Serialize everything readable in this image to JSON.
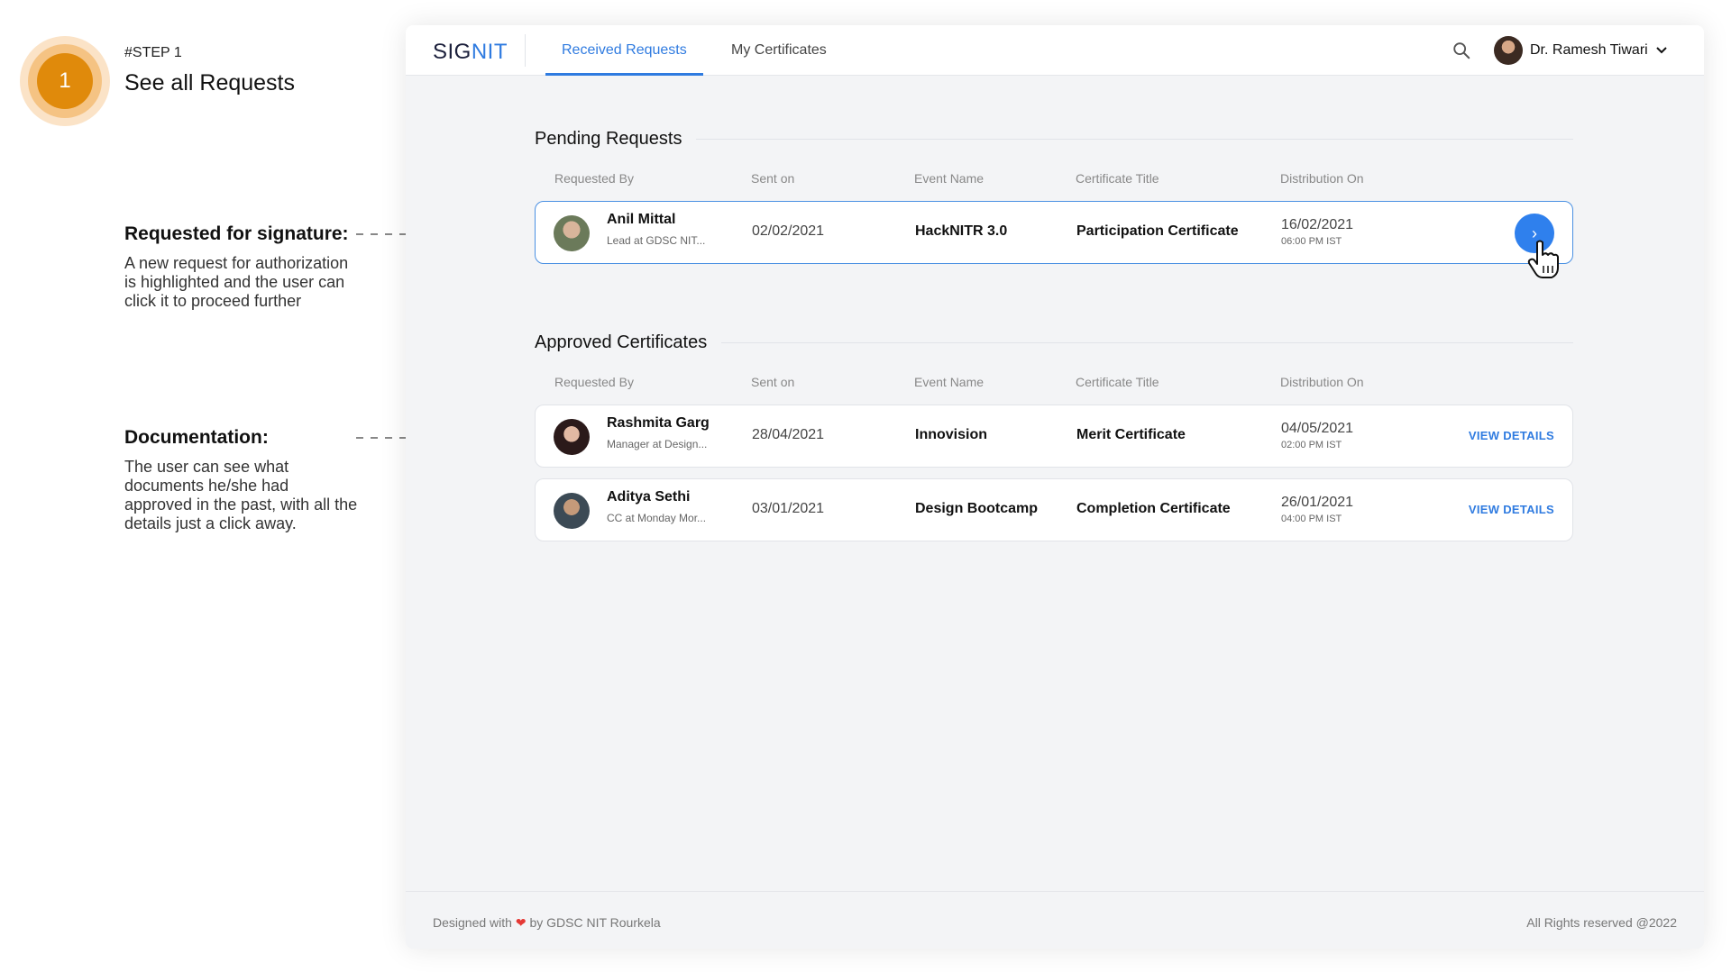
{
  "annotation": {
    "step_number": "1",
    "step_kicker": "#STEP 1",
    "step_title": "See all Requests",
    "notes": [
      {
        "title": "Requested for signature:",
        "body": "A new request for authorization is highlighted and the user can click it to proceed further"
      },
      {
        "title": "Documentation:",
        "body": "The user can see what documents he/she had approved in the past, with all the details just a click away."
      }
    ]
  },
  "app": {
    "logo_part1": "SIG",
    "logo_part2": "NIT",
    "tabs": [
      {
        "label": "Received Requests",
        "active": true
      },
      {
        "label": "My Certificates",
        "active": false
      }
    ],
    "search_icon": "search-icon",
    "user_name": "Dr. Ramesh Tiwari",
    "accent_color": "#2f7be0"
  },
  "columns": [
    "Requested By",
    "Sent on",
    "Event Name",
    "Certificate Title",
    "Distribution On"
  ],
  "pending": {
    "title": "Pending Requests",
    "rows": [
      {
        "name": "Anil Mittal",
        "role": "Lead at GDSC NIT...",
        "sent_on": "02/02/2021",
        "event": "HackNITR 3.0",
        "certificate": "Participation Certificate",
        "dist_date": "16/02/2021",
        "dist_time": "06:00 PM IST",
        "action_icon": "›"
      }
    ]
  },
  "approved": {
    "title": "Approved Certificates",
    "rows": [
      {
        "name": "Rashmita Garg",
        "role": "Manager at Design...",
        "sent_on": "28/04/2021",
        "event": "Innovision",
        "certificate": "Merit Certificate",
        "dist_date": "04/05/2021",
        "dist_time": "02:00 PM IST",
        "action": "VIEW DETAILS"
      },
      {
        "name": "Aditya Sethi",
        "role": "CC at Monday Mor...",
        "sent_on": "03/01/2021",
        "event": "Design Bootcamp",
        "certificate": "Completion Certificate",
        "dist_date": "26/01/2021",
        "dist_time": "04:00 PM IST",
        "action": "VIEW DETAILS"
      }
    ]
  },
  "footer": {
    "left_prefix": "Designed with",
    "heart": "❤",
    "left_suffix": "by GDSC NIT Rourkela",
    "right": "All Rights reserved @2022"
  }
}
